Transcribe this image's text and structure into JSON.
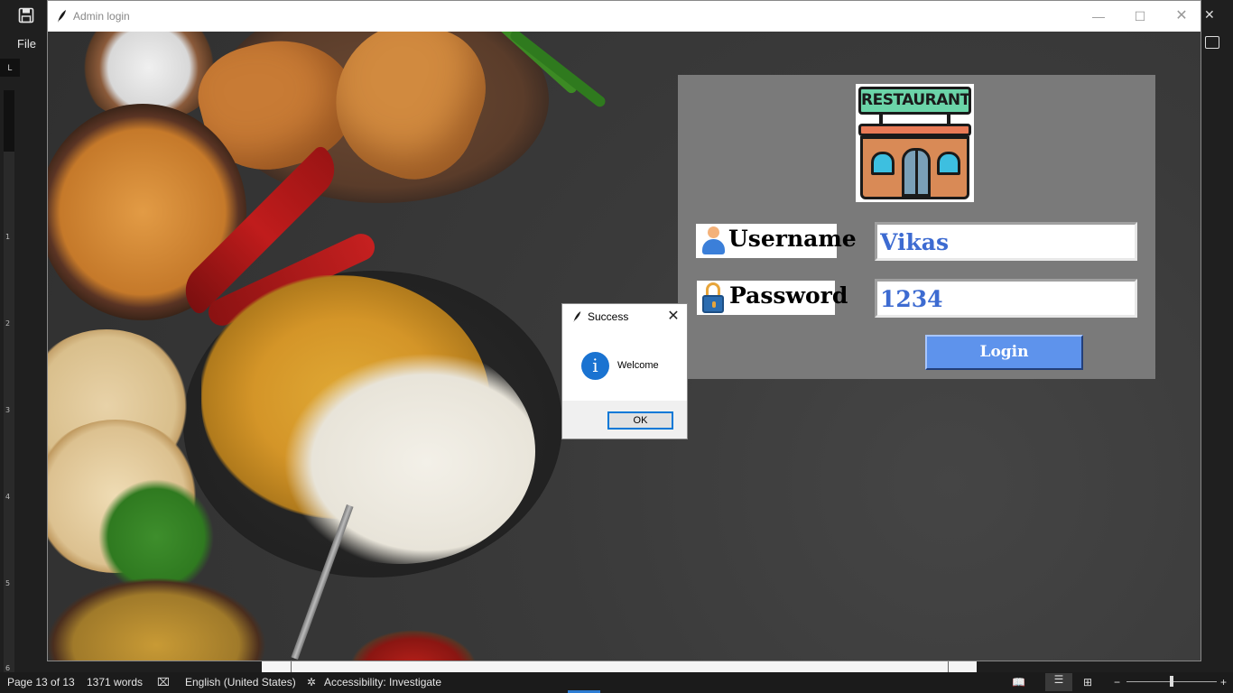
{
  "word": {
    "file_menu": "File",
    "ruler_corner": "L",
    "ruler_numbers": [
      "1",
      "2",
      "3",
      "4",
      "5",
      "6"
    ],
    "status": {
      "page": "Page 13 of 13",
      "words": "1371 words",
      "language": "English (United States)",
      "accessibility": "Accessibility: Investigate"
    }
  },
  "app": {
    "title": "Admin login",
    "logo_text": "RESTAURANT",
    "username_label": "Username",
    "password_label": "Password",
    "username_value": "Vikas",
    "password_value": "1234",
    "login_label": "Login"
  },
  "dialog": {
    "title": "Success",
    "message": "Welcome",
    "ok_label": "OK",
    "icon": "info-icon"
  },
  "colors": {
    "panel": "#7a7a7a",
    "login_button": "#5e93ec",
    "entry_text": "#3d6bd1"
  }
}
